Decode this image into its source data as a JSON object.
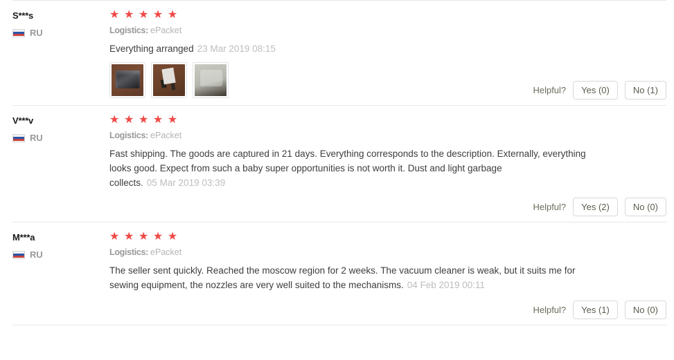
{
  "colors": {
    "star": "#f04a47",
    "divider": "#e8e8e8",
    "text": "#3d3d3d",
    "muted": "#bdbdbd",
    "logistics_label": "#999999",
    "button_border": "#d8d8d8"
  },
  "helpful": {
    "label": "Helpful?"
  },
  "reviews": [
    {
      "author": "S***s",
      "country_code": "RU",
      "country_flag": "ru-flag-icon",
      "rating": 5,
      "logistics_label": "Logistics:",
      "logistics_value": "ePacket",
      "text": "Everything arranged",
      "date": "23 Mar 2019 08:15",
      "thumbnails": [
        "review-photo-product-box",
        "review-photo-accessory-cable",
        "review-photo-gray-bag"
      ],
      "yes_label": "Yes (0)",
      "no_label": "No (1)"
    },
    {
      "author": "V***v",
      "country_code": "RU",
      "country_flag": "ru-flag-icon",
      "rating": 5,
      "logistics_label": "Logistics:",
      "logistics_value": "ePacket",
      "text": "Fast shipping. The goods are captured in 21 days. Everything corresponds to the description. Externally, everything looks good. Expect from such a baby super opportunities is not worth it. Dust and light garbage collects.",
      "date": "05 Mar 2019 03:39",
      "thumbnails": [],
      "yes_label": "Yes (2)",
      "no_label": "No (0)"
    },
    {
      "author": "M***a",
      "country_code": "RU",
      "country_flag": "ru-flag-icon",
      "rating": 5,
      "logistics_label": "Logistics:",
      "logistics_value": "ePacket",
      "text": "The seller sent quickly. Reached the moscow region for 2 weeks. The vacuum cleaner is weak, but it suits me for sewing equipment, the nozzles are very well suited to the mechanisms.",
      "date": "04 Feb 2019 00:11",
      "thumbnails": [],
      "yes_label": "Yes (1)",
      "no_label": "No (0)"
    }
  ]
}
